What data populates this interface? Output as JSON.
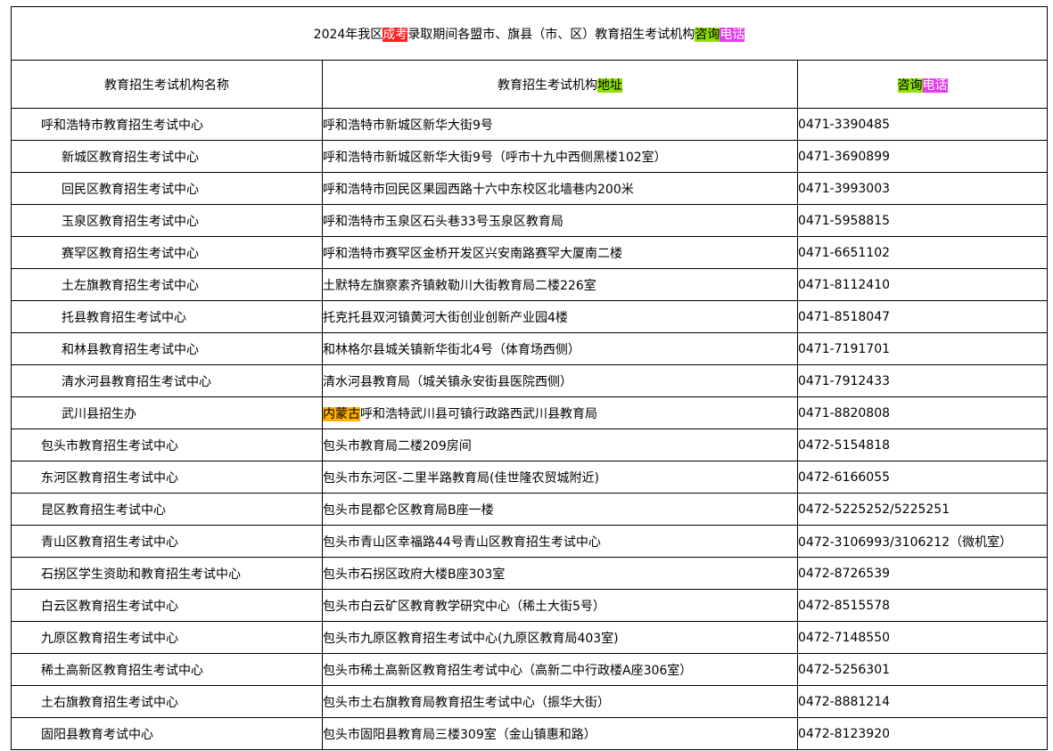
{
  "title": {
    "part1": "2024年我区",
    "hl1": "成考",
    "part2": "录取期间各盟市、旗县（市、区）教育招生考试机构",
    "hl2": "咨询",
    "hl3": "电话"
  },
  "header": {
    "col1": "教育招生考试机构名称",
    "col2_text": "教育招生考试机构",
    "col2_hl": "地址",
    "col3_hl1": "咨询",
    "col3_hl2": "电话"
  },
  "colors": {
    "red_highlight": "#ff1f1f",
    "green_highlight": "#8fe000",
    "magenta_highlight": "#e53cf0",
    "orange_highlight": "#ffb000"
  },
  "rows": [
    {
      "name": "呼和浩特市教育招生考试中心",
      "address": "呼和浩特市新城区新华大街9号",
      "phone": "0471-3390485"
    },
    {
      "name": "新城区教育招生考试中心",
      "address": "呼和浩特市新城区新华大街9号（呼市十九中西侧黑楼102室）",
      "phone": "0471-3690899"
    },
    {
      "name": "回民区教育招生考试中心",
      "address": "呼和浩特市回民区果园西路十六中东校区北墙巷内200米",
      "phone": "0471-3993003"
    },
    {
      "name": "玉泉区教育招生考试中心",
      "address": "呼和浩特市玉泉区石头巷33号玉泉区教育局",
      "phone": "0471-5958815"
    },
    {
      "name": "赛罕区教育招生考试中心",
      "address": "呼和浩特市赛罕区金桥开发区兴安南路赛罕大厦南二楼",
      "phone": "0471-6651102"
    },
    {
      "name": "土左旗教育招生考试中心",
      "address": "土默特左旗察素齐镇敕勒川大街教育局二楼226室",
      "phone": "0471-8112410"
    },
    {
      "name": "托县教育招生考试中心",
      "address": "托克托县双河镇黄河大街创业创新产业园4楼",
      "phone": "0471-8518047"
    },
    {
      "name": "和林县教育招生考试中心",
      "address": "和林格尔县城关镇新华街北4号（体育场西侧）",
      "phone": "0471-7191701"
    },
    {
      "name": "清水河县教育招生考试中心",
      "address": "清水河县教育局（城关镇永安街县医院西侧）",
      "phone": "0471-7912433"
    },
    {
      "name": "武川县招生办",
      "address_hl": "内蒙古",
      "address": "呼和浩特武川县可镇行政路西武川县教育局",
      "phone": "0471-8820808"
    },
    {
      "name": "包头市教育招生考试中心",
      "address": "包头市教育局二楼209房间",
      "phone": "0472-5154818"
    },
    {
      "name": "东河区教育招生考试中心",
      "address": "包头市东河区-二里半路教育局(佳世隆农贸城附近)",
      "phone": "0472-6166055"
    },
    {
      "name": "昆区教育招生考试中心",
      "address": "包头市昆都仑区教育局B座一楼",
      "phone": "0472-5225252/5225251"
    },
    {
      "name": "青山区教育招生考试中心",
      "address": "包头市青山区幸福路44号青山区教育招生考试中心",
      "phone": "0472-3106993/3106212（微机室）"
    },
    {
      "name": "石拐区学生资助和教育招生考试中心",
      "address": "包头市石拐区政府大楼B座303室",
      "phone": "0472-8726539"
    },
    {
      "name": "白云区教育招生考试中心",
      "address": "包头市白云矿区教育教学研究中心（稀土大街5号）",
      "phone": "0472-8515578"
    },
    {
      "name": "九原区教育招生考试中心",
      "address": "包头市九原区教育招生考试中心(九原区教育局403室)",
      "phone": "0472-7148550"
    },
    {
      "name": "稀土高新区教育招生考试中心",
      "address": "包头市稀土高新区教育招生考试中心（高新二中行政楼A座306室）",
      "phone": "0472-5256301"
    },
    {
      "name": "土右旗教育招生考试中心",
      "address": "包头市土右旗教育局教育招生考试中心（振华大街）",
      "phone": "0472-8881214"
    },
    {
      "name": "固阳县教育考试中心",
      "address": "包头市固阳县教育局三楼309室（金山镇惠和路）",
      "phone": "0472-8123920"
    }
  ]
}
